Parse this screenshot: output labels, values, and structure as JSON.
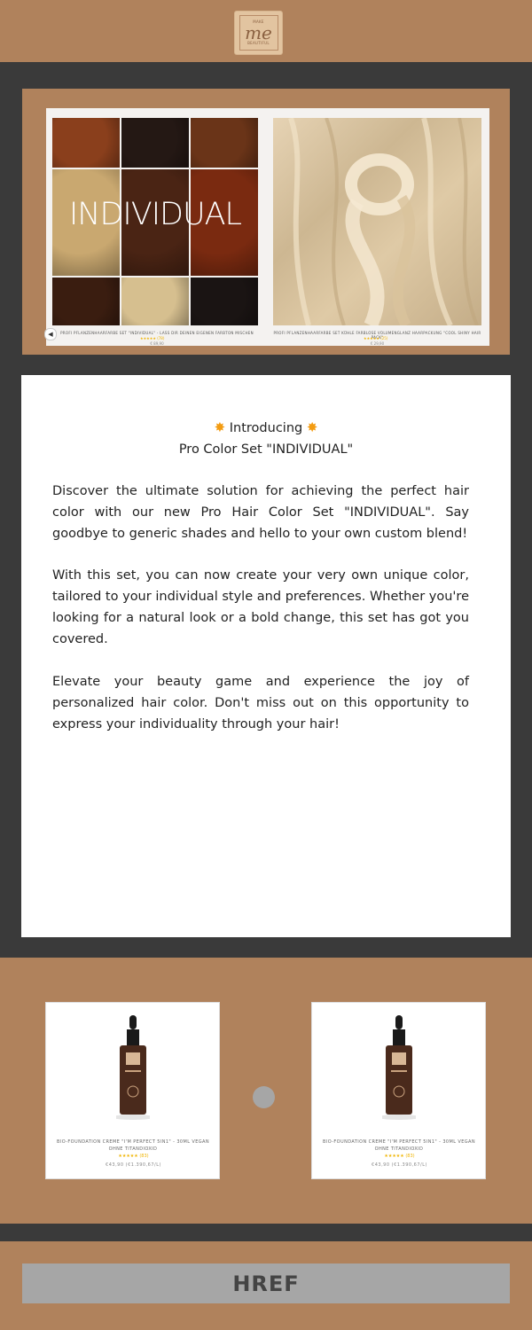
{
  "header": {
    "logo_top": "MAKE",
    "logo_me": "me",
    "logo_bottom": "BEAUTIFUL"
  },
  "hero": {
    "overlay_text": "INDIVIDUAL",
    "items": [
      {
        "caption": "PROFI PFLANZENHAARFARBE SET \"INDIVIDUAL\" - LASS DIR DEINEN EIGENEN FARBTON MISCHEN",
        "stars": "★★★★★ (78)",
        "price": "€ 89,90"
      },
      {
        "caption": "PROFI PFLANZENHAARFARBE SET KÜHLE FARBLOSE VOLUMENGLANZ HAARPACKUNG \"COOL SHINY HAIR PACK\"",
        "stars": "★★★★★ (25)",
        "price": "€ 29,90"
      }
    ],
    "swatch_colors": [
      "#8a3f1c",
      "#241814",
      "#6a3418",
      "#c9a870",
      "#4a2414",
      "#7a2a10",
      "#3a1d10",
      "#d6bf8f",
      "#1a1413"
    ]
  },
  "intro": {
    "line1": "Introducing",
    "line2": "Pro Color Set \"INDIVIDUAL\"",
    "para1": "Discover the ultimate solution for achieving the perfect hair color with our new Pro Hair Color Set \"INDIVIDUAL\". Say goodbye to generic shades and hello to your own custom blend!",
    "para2": "With this set, you can now create your very own unique color, tailored to your individual style and preferences. Whether you're looking for a natural look or a bold change, this set has got you covered.",
    "para3": "Elevate your beauty game and experience the joy of personalized hair color. Don't miss out on this opportunity to express your individuality through your hair!"
  },
  "products": [
    {
      "name": "BIO-FOUNDATION CREME \"I'M PERFECT 5IN1\" - 30ML VEGAN OHNE TITANDIOXID",
      "stars": "★★★★★ (83)",
      "price": "€43,90 (€1.390,67/L)"
    },
    {
      "name": "BIO-FOUNDATION CREME \"I'M PERFECT 5IN1\" - 30ML VEGAN OHNE TITANDIOXID",
      "stars": "★★★★★ (83)",
      "price": "€43,90 (€1.390,67/L)"
    }
  ],
  "footer": {
    "button_label": "HREF"
  }
}
